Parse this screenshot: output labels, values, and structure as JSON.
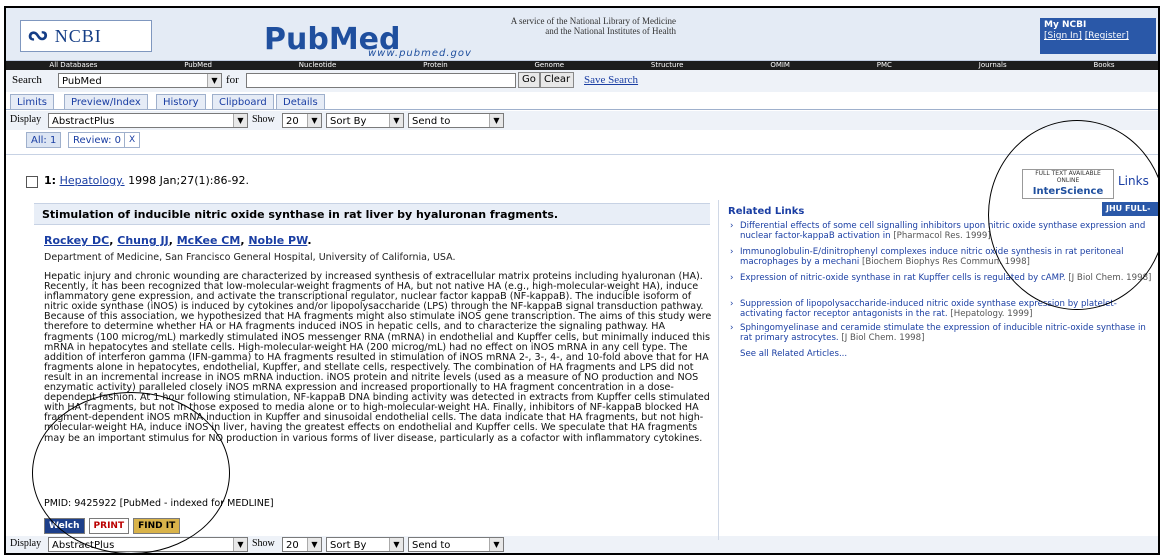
{
  "header": {
    "ncbi_label": "NCBI",
    "pubmed_label": "PubMed",
    "pubmed_url": "www.pubmed.gov",
    "service_line1": "A service of the National Library of Medicine",
    "service_line2": "and the National Institutes of Health",
    "my_ncbi": "My NCBI",
    "sign_in": "[Sign In]",
    "register": "[Register]"
  },
  "db_nav": [
    "All Databases",
    "PubMed",
    "Nucleotide",
    "Protein",
    "Genome",
    "Structure",
    "OMIM",
    "PMC",
    "Journals",
    "Books"
  ],
  "search": {
    "label": "Search",
    "db_value": "PubMed",
    "for_label": "for",
    "go": "Go",
    "clear": "Clear",
    "save": "Save Search"
  },
  "tabs": [
    "Limits",
    "Preview/Index",
    "History",
    "Clipboard",
    "Details"
  ],
  "display_bar": {
    "display_label": "Display",
    "display_value": "AbstractPlus",
    "show_label": "Show",
    "show_value": "20",
    "sort_value": "Sort By",
    "send_value": "Send to"
  },
  "filters": {
    "all": "All: 1",
    "review": "Review: 0",
    "icon": "X"
  },
  "citation": {
    "index": "1:",
    "journal": "Hepatology.",
    "details": "1998 Jan;27(1):86-92.",
    "badge_top": "FULL TEXT AVAILABLE ONLINE",
    "badge_brand": "InterScience",
    "links": "Links"
  },
  "article": {
    "title": "Stimulation of inducible nitric oxide synthase in rat liver by hyaluronan fragments.",
    "authors": [
      "Rockey DC",
      "Chung JJ",
      "McKee CM",
      "Noble PW"
    ],
    "affiliation": "Department of Medicine, San Francisco General Hospital, University of California, USA.",
    "abstract": "Hepatic injury and chronic wounding are characterized by increased synthesis of extracellular matrix proteins including hyaluronan (HA). Recently, it has been recognized that low-molecular-weight fragments of HA, but not native HA (e.g., high-molecular-weight HA), induce inflammatory gene expression, and activate the transcriptional regulator, nuclear factor kappaB (NF-kappaB). The inducible isoform of nitric oxide synthase (iNOS) is induced by cytokines and/or lipopolysaccharide (LPS) through the NF-kappaB signal transduction pathway. Because of this association, we hypothesized that HA fragments might also stimulate iNOS gene transcription. The aims of this study were therefore to determine whether HA or HA fragments induced iNOS in hepatic cells, and to characterize the signaling pathway. HA fragments (100 microg/mL) markedly stimulated iNOS messenger RNA (mRNA) in endothelial and Kupffer cells, but minimally induced this mRNA in hepatocytes and stellate cells. High-molecular-weight HA (200 microg/mL) had no effect on iNOS mRNA in any cell type. The addition of interferon gamma (IFN-gamma) to HA fragments resulted in stimulation of iNOS mRNA 2-, 3-, 4-, and 10-fold above that for HA fragments alone in hepatocytes, endothelial, Kupffer, and stellate cells, respectively. The combination of HA fragments and LPS did not result in an incremental increase in iNOS mRNA induction. iNOS protein and nitrite levels (used as a measure of NO production and NOS enzymatic activity) paralleled closely iNOS mRNA expression and increased proportionally to HA fragment concentration in a dose-dependent fashion. At 1 hour following stimulation, NF-kappaB DNA binding activity was detected in extracts from Kupffer cells stimulated with HA fragments, but not in those exposed to media alone or to high-molecular-weight HA. Finally, inhibitors of NF-kappaB blocked HA fragment-dependent iNOS mRNA induction in Kupffer and sinusoidal endothelial cells. The data indicate that HA fragments, but not high-molecular-weight HA, induce iNOS in liver, having the greatest effects on endothelial and Kupffer cells. We speculate that HA fragments may be an important stimulus for NO production in various forms of liver disease, particularly as a cofactor with inflammatory cytokines.",
    "pmid": "PMID: 9425922 [PubMed - indexed for MEDLINE]",
    "btn_webbridge": "Welch",
    "btn_print": "PRINT",
    "btn_findit": "FIND IT"
  },
  "related": {
    "heading": "Related Links",
    "jhu": "JHU FULL-TEXT",
    "items": [
      {
        "text": "Differential effects of some cell signalling inhibitors upon nitric oxide synthase expression and nuclear factor-kappaB activation in",
        "src": "[Pharmacol Res. 1999]"
      },
      {
        "text": "Immunoglobulin-E/dinitrophenyl complexes induce nitric oxide synthesis in rat peritoneal macrophages by a mechani",
        "src": "[Biochem Biophys Res Commun. 1998]"
      },
      {
        "text": "Expression of nitric-oxide synthase in rat Kupffer cells is regulated by cAMP.",
        "src": "[J Biol Chem. 1998]"
      },
      {
        "text": "Suppression of lipopolysaccharide-induced nitric oxide synthase expression by platelet-activating factor receptor antagonists in the rat.",
        "src": "[Hepatology. 1999]"
      },
      {
        "text": "Sphingomyelinase and ceramide stimulate the expression of inducible nitric-oxide synthase in rat primary astrocytes.",
        "src": "[J Biol Chem. 1998]"
      }
    ],
    "see_all": "See all Related Articles..."
  }
}
